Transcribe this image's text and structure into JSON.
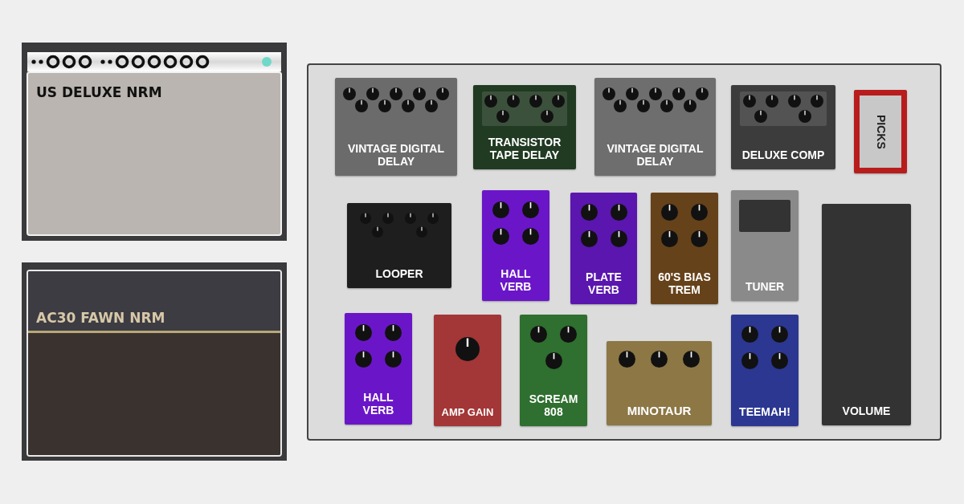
{
  "amps": [
    {
      "kind": "blackface",
      "name": "US DELUXE NRM"
    },
    {
      "kind": "ac30",
      "name": "AC30 FAWN NRM"
    }
  ],
  "pedalboard": {
    "pedals": [
      {
        "kind": "ten-knob",
        "label": "VINTAGE DIGITAL DELAY",
        "color": "#6b6b6b"
      },
      {
        "kind": "six-knob-panel",
        "label": "TRANSISTOR TAPE DELAY",
        "color": "#213a22"
      },
      {
        "kind": "ten-knob",
        "label": "VINTAGE DIGITAL DELAY",
        "color": "#6e6e6e"
      },
      {
        "kind": "six-knob-panel",
        "label": "DELUXE COMP",
        "color": "#3c3c3c"
      },
      {
        "kind": "picks",
        "label": "PICKS",
        "color": "#b81c1c"
      },
      {
        "kind": "six-knob",
        "label": "LOOPER",
        "color": "#1e1e1e"
      },
      {
        "kind": "quad",
        "label": "HALL VERB",
        "color": "#6a16c8"
      },
      {
        "kind": "quad",
        "label": "PLATE VERB",
        "color": "#5a16ae"
      },
      {
        "kind": "quad",
        "label": "60'S BIAS TREM",
        "color": "#66421a"
      },
      {
        "kind": "tuner",
        "label": "TUNER",
        "color": "#8a8a8a"
      },
      {
        "kind": "quad",
        "label": "HALL VERB",
        "color": "#6a16c8"
      },
      {
        "kind": "single",
        "label": "AMP GAIN",
        "color": "#a33636"
      },
      {
        "kind": "triad",
        "label": "SCREAM 808",
        "color": "#2f6f2f"
      },
      {
        "kind": "row-three",
        "label": "MINOTAUR",
        "color": "#8c7745"
      },
      {
        "kind": "quad",
        "label": "TEEMAH!",
        "color": "#2b3791"
      },
      {
        "kind": "treadle",
        "label": "VOLUME",
        "color": "#333333"
      }
    ]
  }
}
